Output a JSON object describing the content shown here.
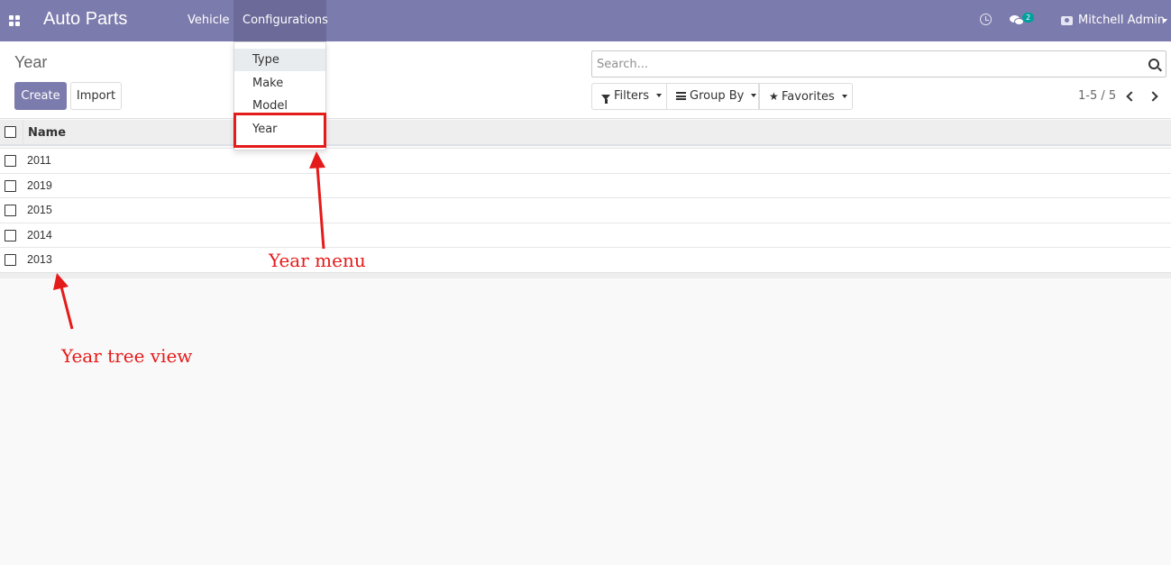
{
  "navbar": {
    "app_title": "Auto Parts",
    "menu": [
      {
        "label": "Vehicle"
      },
      {
        "label": "Configurations"
      }
    ],
    "messages_badge": "2",
    "user_name": "Mitchell Admin",
    "bg_color": "#7c7bad"
  },
  "dropdown": {
    "items": [
      {
        "label": "Type"
      },
      {
        "label": "Make"
      },
      {
        "label": "Model"
      },
      {
        "label": "Year"
      }
    ]
  },
  "control_panel": {
    "breadcrumb": "Year",
    "create_label": "Create",
    "import_label": "Import",
    "search_placeholder": "Search...",
    "filters_label": "Filters",
    "groupby_label": "Group By",
    "favorites_label": "Favorites",
    "pager": "1-5 / 5"
  },
  "list": {
    "columns": [
      {
        "label": "Name"
      }
    ],
    "rows": [
      {
        "name": "2011"
      },
      {
        "name": "2019"
      },
      {
        "name": "2015"
      },
      {
        "name": "2014"
      },
      {
        "name": "2013"
      }
    ]
  },
  "annotations": {
    "year_menu": "Year menu",
    "tree_view": "Year tree view",
    "color": "#e51a1a"
  },
  "icons": {
    "apps": "apps-grid-icon",
    "clock": "clock-icon",
    "chat": "chat-icon",
    "user": "camera-icon",
    "search": "search-icon",
    "filter": "filter-icon",
    "groupby": "bars-icon",
    "favorites": "star-icon"
  }
}
